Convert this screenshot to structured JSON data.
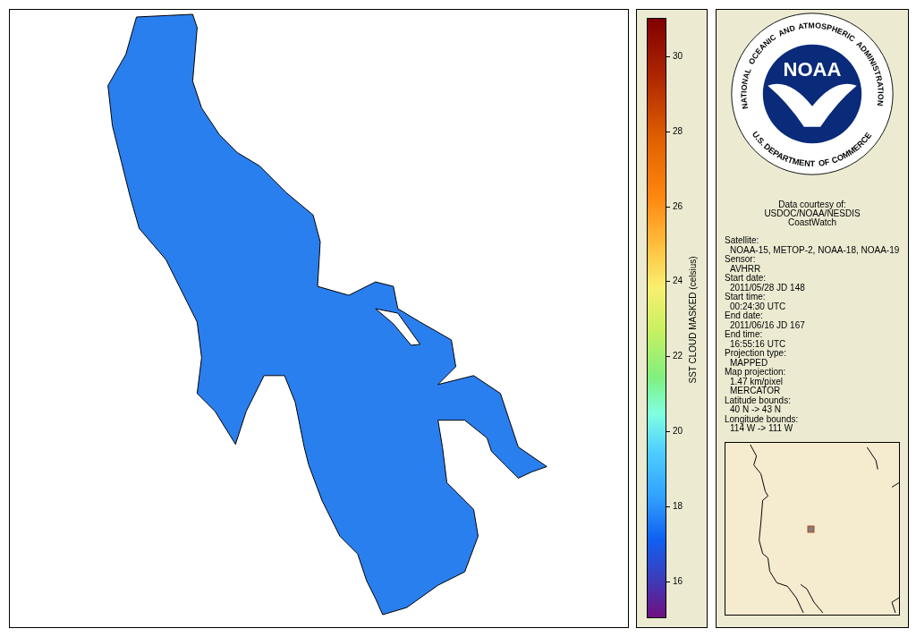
{
  "colorbar": {
    "title": "SST CLOUD MASKED (celsius)",
    "ticks": [
      "30",
      "28",
      "26",
      "24",
      "22",
      "20",
      "18",
      "16"
    ]
  },
  "logo": {
    "ring_top": [
      "NATIONAL",
      "OCEANIC",
      "AND",
      "ATMOSPHERIC",
      "ADMINISTRATION"
    ],
    "ring_bottom": [
      "U.S.",
      "DEPARTMENT",
      "OF",
      "COMMERCE"
    ],
    "center": "NOAA"
  },
  "credit": [
    "Data courtesy of:",
    "USDOC/NOAA/NESDIS",
    "CoastWatch"
  ],
  "info": [
    {
      "kind": "label",
      "text": "Satellite:"
    },
    {
      "kind": "value",
      "text": "NOAA-15, METOP-2, NOAA-18, NOAA-19"
    },
    {
      "kind": "label",
      "text": "Sensor:"
    },
    {
      "kind": "value",
      "text": "AVHRR"
    },
    {
      "kind": "label",
      "text": "Start date:"
    },
    {
      "kind": "value",
      "text": "2011/05/28 JD 148"
    },
    {
      "kind": "label",
      "text": "Start time:"
    },
    {
      "kind": "value",
      "text": "00:24:30 UTC"
    },
    {
      "kind": "label",
      "text": "End date:"
    },
    {
      "kind": "value",
      "text": "2011/06/16 JD 167"
    },
    {
      "kind": "label",
      "text": "End time:"
    },
    {
      "kind": "value",
      "text": "16:55:16 UTC"
    },
    {
      "kind": "label",
      "text": "Projection type:"
    },
    {
      "kind": "value",
      "text": "MAPPED"
    },
    {
      "kind": "label",
      "text": "Map projection:"
    },
    {
      "kind": "value",
      "text": "1.47 km/pixel"
    },
    {
      "kind": "value",
      "text": "MERCATOR"
    },
    {
      "kind": "label",
      "text": "Latitude bounds:"
    },
    {
      "kind": "value",
      "text": "40 N -> 43 N"
    },
    {
      "kind": "label",
      "text": "Longitude bounds:"
    },
    {
      "kind": "value",
      "text": "114 W -> 111 W"
    }
  ]
}
